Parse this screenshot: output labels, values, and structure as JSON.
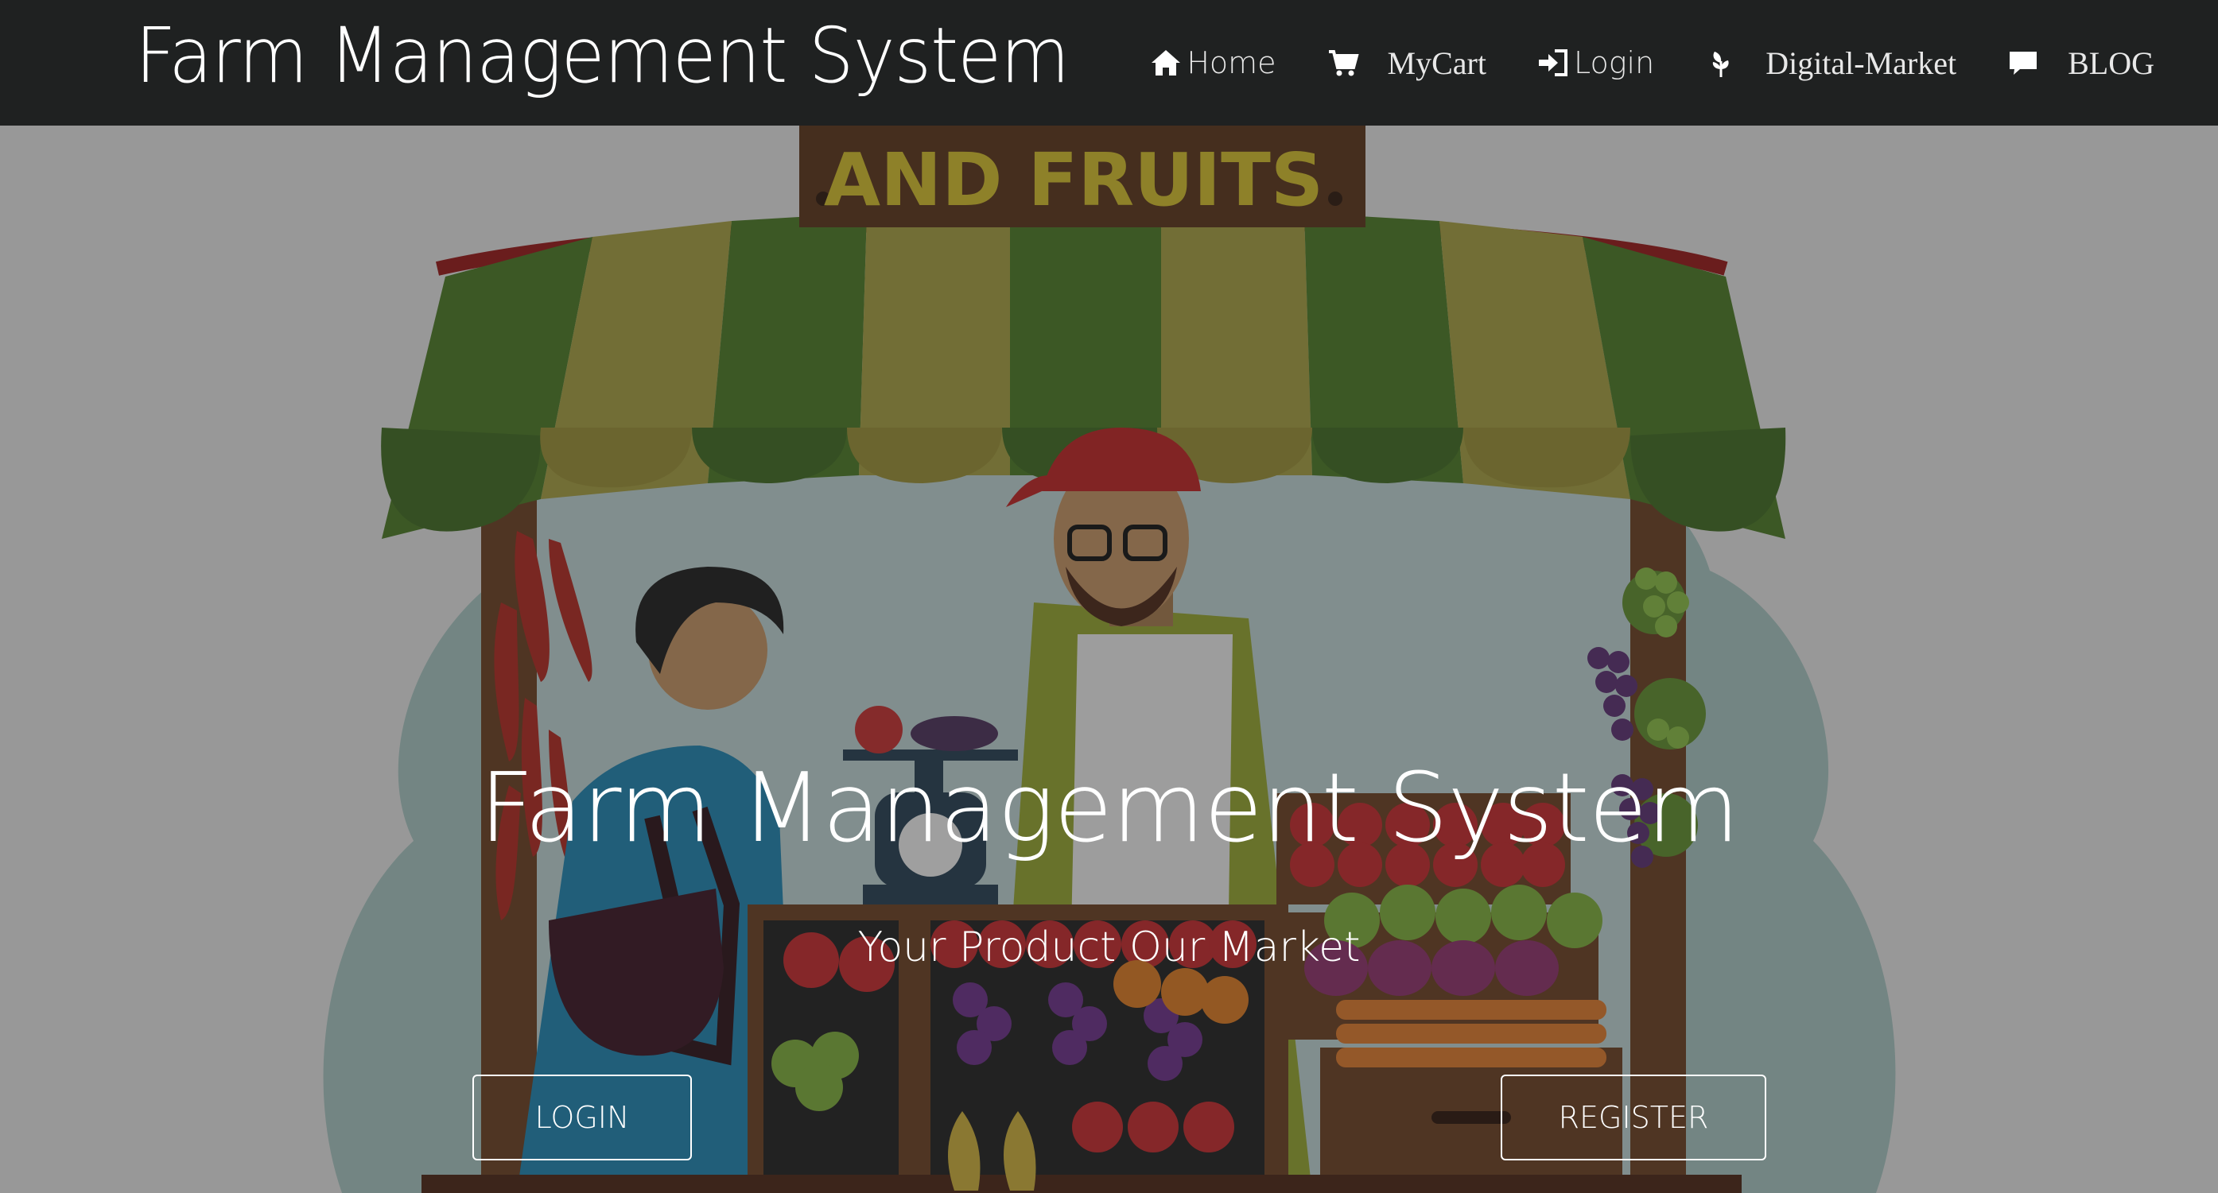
{
  "brand": {
    "title": "Farm Management System"
  },
  "nav": {
    "items": [
      {
        "label": "Home",
        "icon": "home-icon"
      },
      {
        "label": "MyCart",
        "icon": "cart-icon"
      },
      {
        "label": "Login",
        "icon": "login-icon"
      },
      {
        "label": "Digital-Market",
        "icon": "leaf-icon"
      },
      {
        "label": "BLOG",
        "icon": "comment-icon"
      }
    ]
  },
  "hero": {
    "title": "Farm Management System",
    "subtitle": "Your Product Our Market",
    "login_label": "LOGIN",
    "register_label": "REGISTER",
    "sign_text": "AND FRUITS"
  },
  "colors": {
    "navbar": "#1f2121",
    "overlay": "#8f8f8f",
    "awning_green": "#4a6e28",
    "awning_yellow": "#8d8a3a",
    "sign_brown": "#5a3318"
  }
}
